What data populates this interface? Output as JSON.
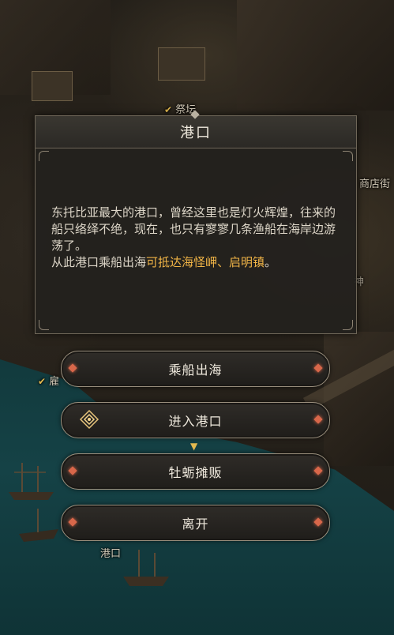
{
  "map": {
    "labels": {
      "altar": "祭坛",
      "shop_street": "商店街",
      "partial_left": "雇",
      "partial_right": "神",
      "harbor": "港口"
    }
  },
  "dialog": {
    "title": "港口",
    "body_line1": "东托比亚最大的港口，曾经这里也是灯火辉煌，往来的船只络绎不绝，现在，也只有寥寥几条渔船在海岸边游荡了。",
    "body_line2_prefix": "从此港口乘船出海",
    "body_line2_highlight": "可抵达海怪岬、启明镇",
    "body_line2_suffix": "。"
  },
  "options": [
    {
      "label": "乘船出海"
    },
    {
      "label": "进入港口"
    },
    {
      "label": "牡蛎摊贩"
    },
    {
      "label": "离开"
    }
  ],
  "colors": {
    "highlight": "#f0b446",
    "gem": "#d8674a",
    "map_tick": "#e3b94f"
  }
}
